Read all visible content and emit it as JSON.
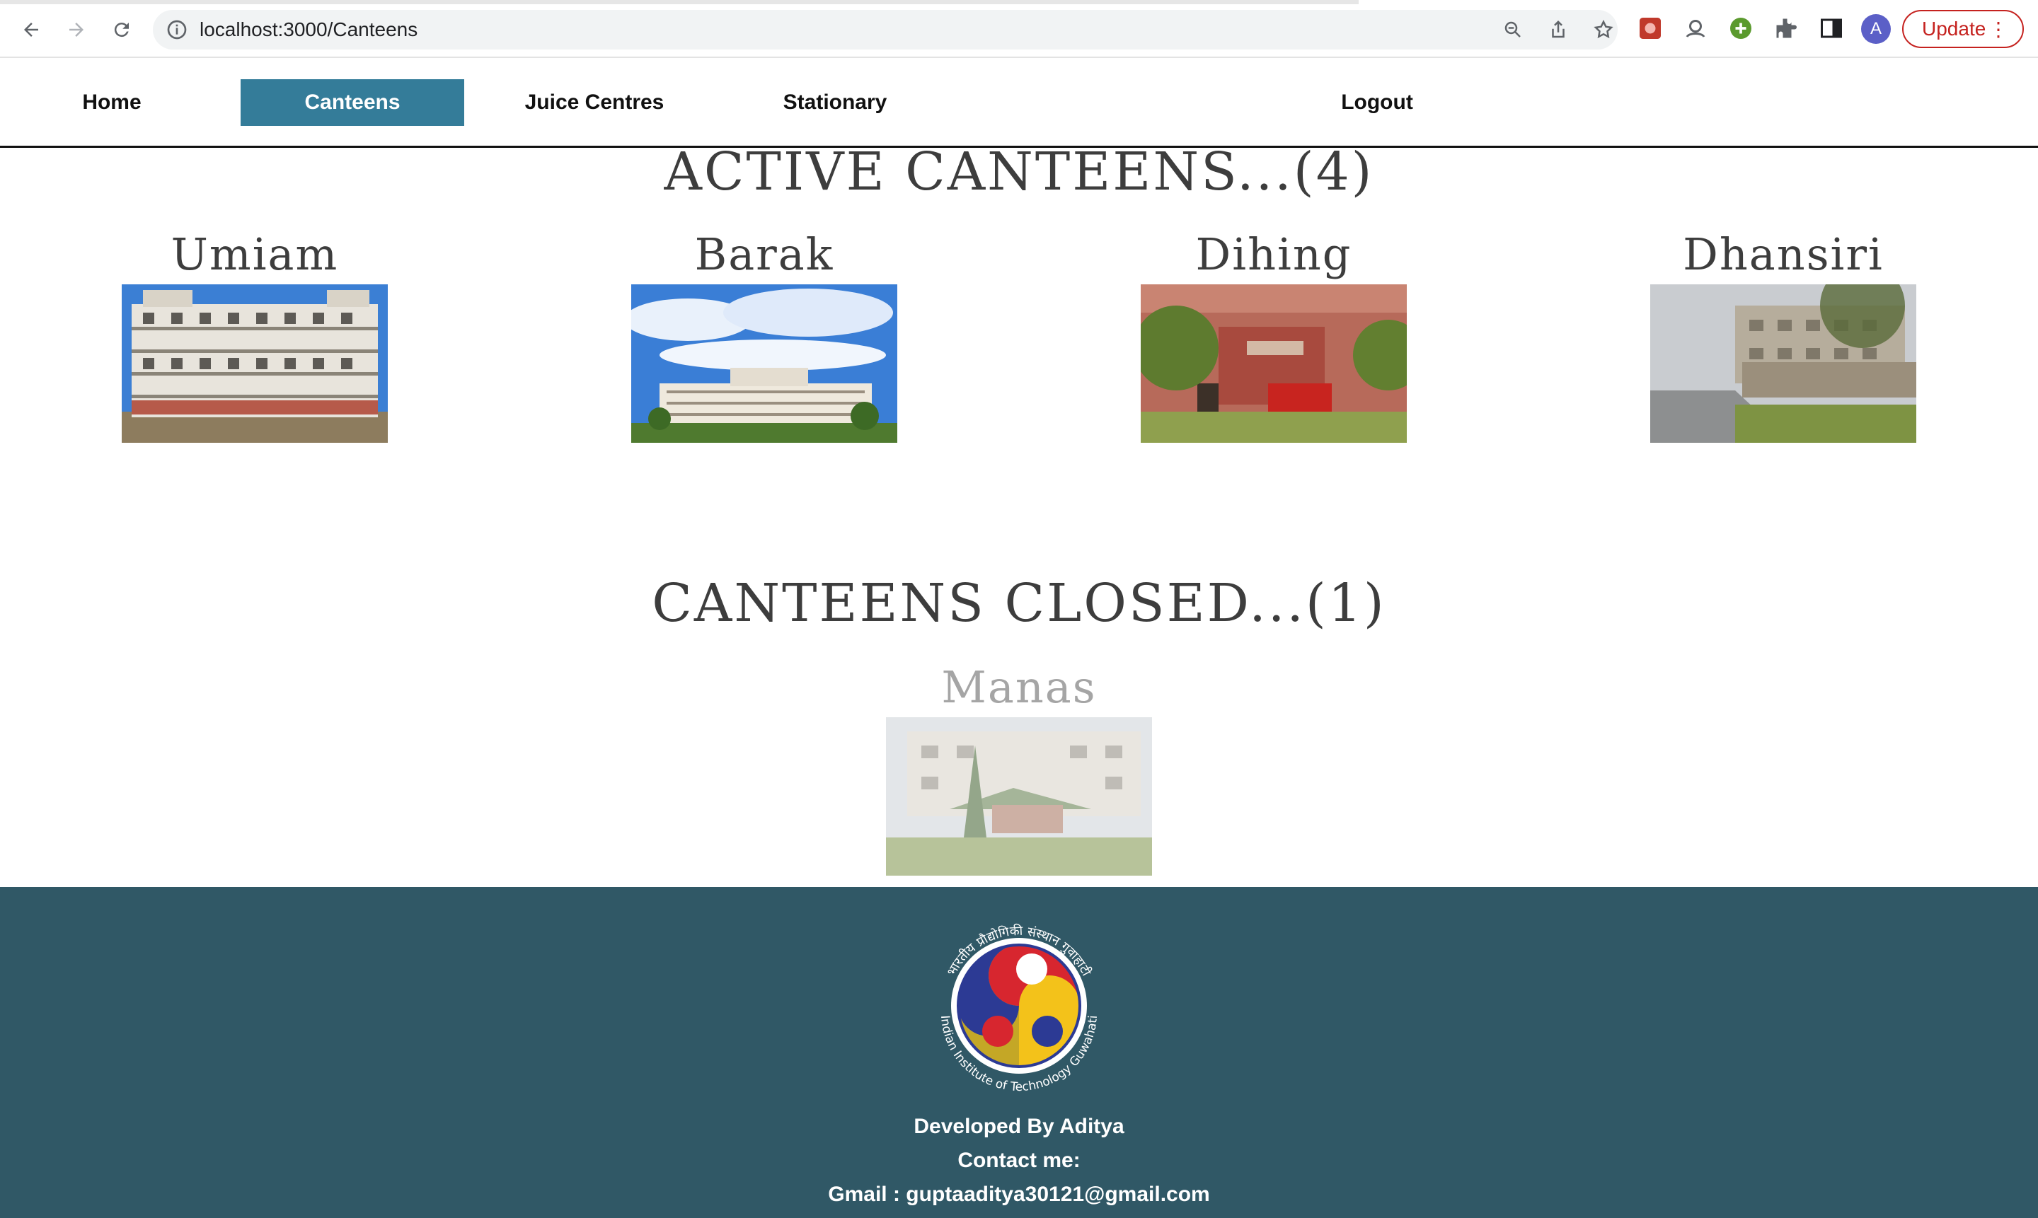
{
  "browser": {
    "url": "localhost:3000/Canteens",
    "update_label": "Update",
    "avatar_letter": "A"
  },
  "nav": {
    "items": [
      {
        "label": "Home",
        "active": false
      },
      {
        "label": "Canteens",
        "active": true
      },
      {
        "label": "Juice Centres",
        "active": false
      },
      {
        "label": "Stationary",
        "active": false
      }
    ],
    "logout_label": "Logout",
    "active_color": "#347c99"
  },
  "active_section": {
    "title": "ACTIVE CANTEENS...(4)",
    "canteens": [
      {
        "name": "Umiam"
      },
      {
        "name": "Barak"
      },
      {
        "name": "Dihing"
      },
      {
        "name": "Dhansiri"
      }
    ]
  },
  "closed_section": {
    "title": "CANTEENS CLOSED...(1)",
    "canteens": [
      {
        "name": "Manas"
      }
    ]
  },
  "footer": {
    "logo_text_top": "भारतीय प्रौद्योगिकी संस्थान गुवाहाटी",
    "logo_text_bottom": "Indian Institute of Technology Guwahati",
    "developed_by": "Developed By Aditya",
    "contact_label": "Contact me:",
    "gmail": "Gmail : guptaaditya30121@gmail.com",
    "background_color": "#305866"
  }
}
